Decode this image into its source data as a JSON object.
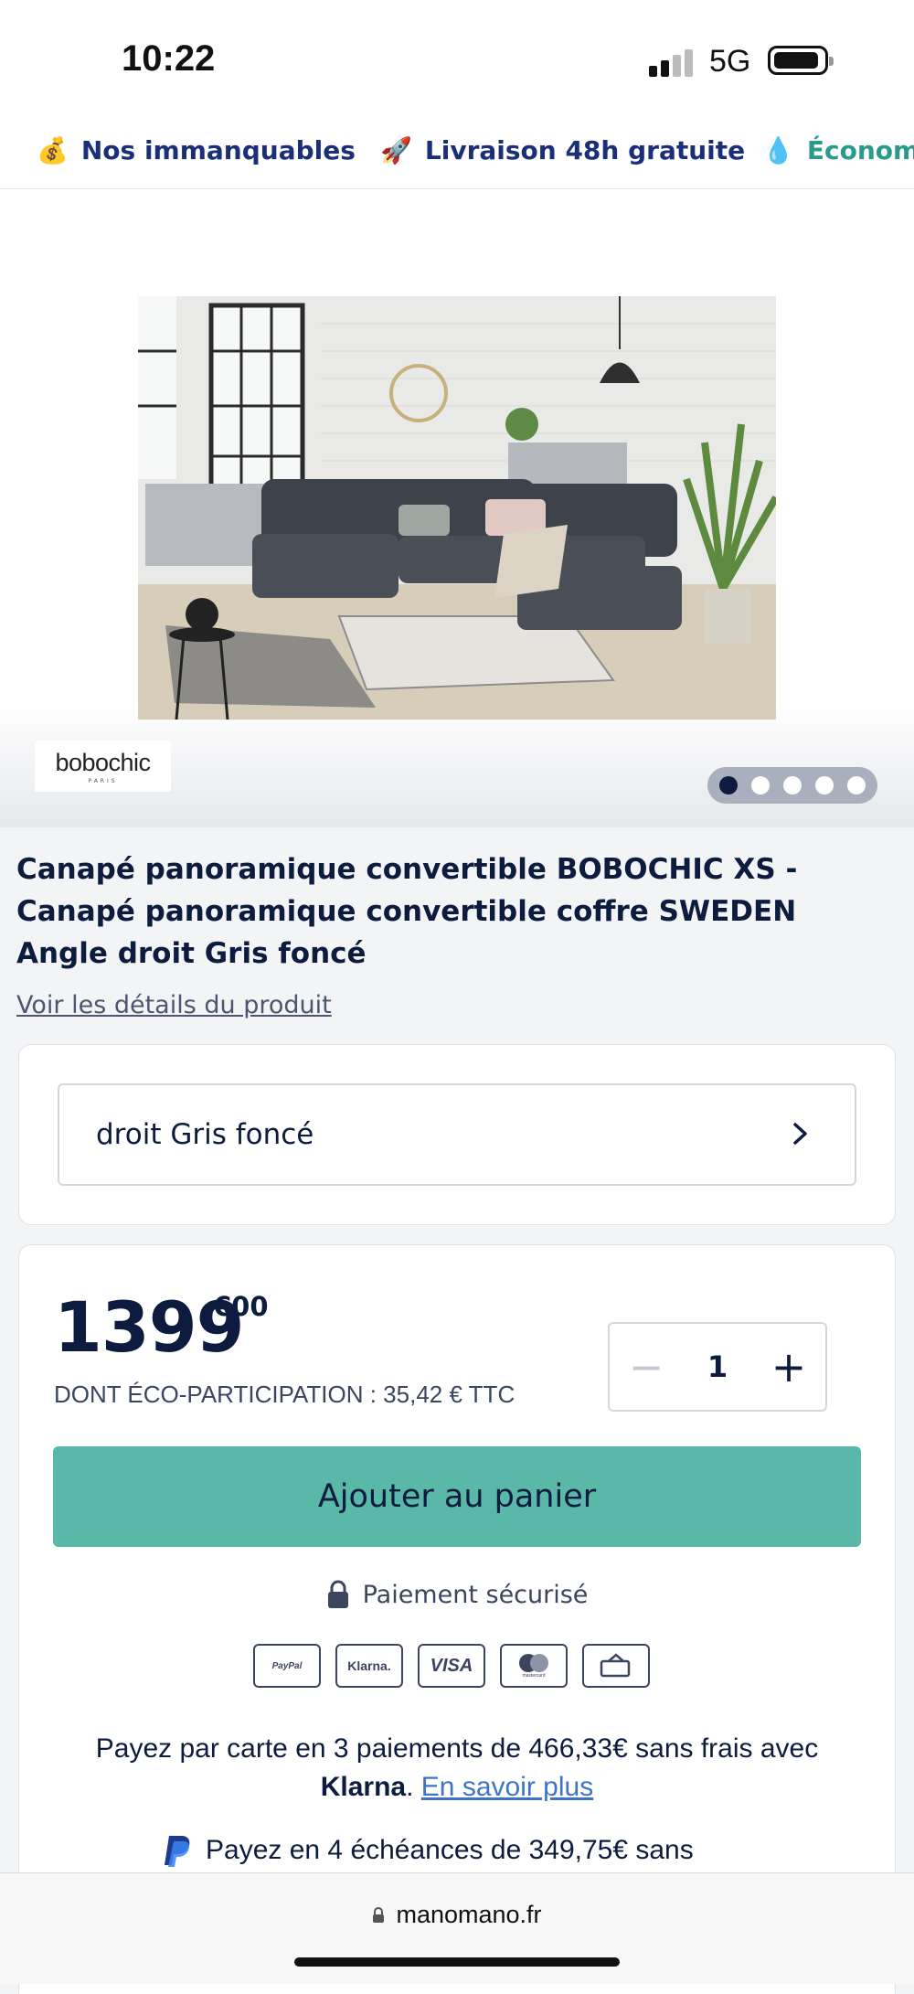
{
  "status_bar": {
    "time": "10:22",
    "network": "5G"
  },
  "promo_bar": {
    "items": [
      {
        "icon": "money-bag-icon",
        "label": "Nos immanquables"
      },
      {
        "icon": "rocket-icon",
        "label": "Livraison 48h gratuite"
      },
      {
        "icon": "droplet-icon",
        "label": "Économi"
      }
    ]
  },
  "gallery": {
    "brand": "bobochic",
    "brand_sub": "PARIS",
    "slides_total": 5,
    "active_slide": 1
  },
  "product": {
    "title": "Canapé panoramique convertible BOBOCHIC XS - Canapé panoramique convertible coffre SWEDEN Angle droit Gris foncé",
    "details_link": "Voir les détails du produit",
    "variant": "droit Gris foncé"
  },
  "purchase": {
    "price_main": "1399",
    "price_cents": "€00",
    "eco_participation": "DONT ÉCO-PARTICIPATION : 35,42 € TTC",
    "quantity": "1",
    "minus": "−",
    "plus": "+",
    "add_to_cart": "Ajouter au panier",
    "secure_payment": "Paiement sécurisé",
    "payment_logos": [
      "PayPal",
      "Klarna.",
      "VISA",
      "mastercard",
      "transfer"
    ],
    "klarna_text": "Payez par carte en 3 paiements de 466,33€ sans frais avec",
    "klarna_brand": "Klarna",
    "klarna_link": "En savoir plus",
    "paypal_text": "Payez en 4 échéances de 349,75€ sans"
  },
  "browser": {
    "url": "manomano.fr"
  }
}
